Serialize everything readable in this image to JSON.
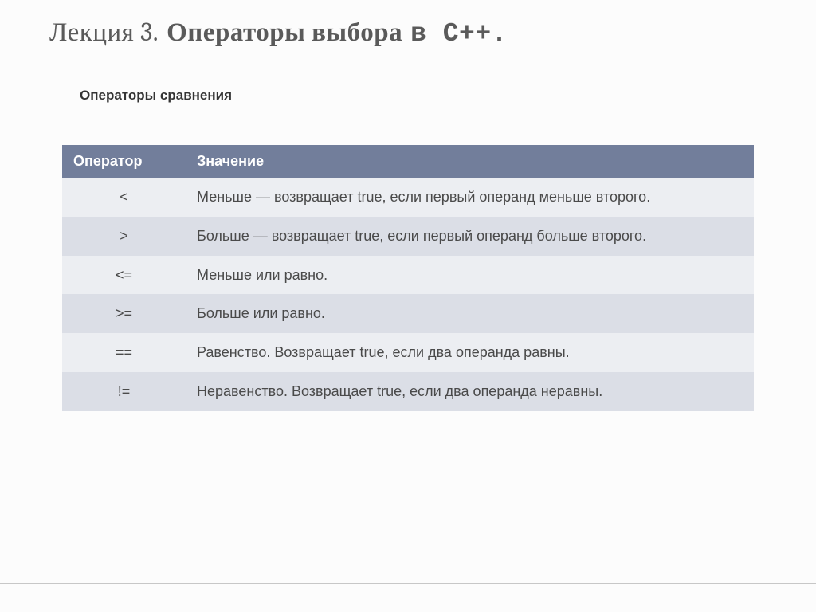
{
  "title": {
    "lecture": "Лекция 3.",
    "bold": "Операторы выбора",
    "mono": "в С++."
  },
  "subtitle": "Операторы сравнения",
  "table": {
    "header": {
      "operator": "Оператор",
      "value": "Значение"
    },
    "rows": [
      {
        "op": "<",
        "val": "Меньше — возвращает true, если первый операнд меньше второго."
      },
      {
        "op": ">",
        "val": "Больше — возвращает true, если первый операнд больше второго."
      },
      {
        "op": "<=",
        "val": "Меньше или равно."
      },
      {
        "op": ">=",
        "val": "Больше или равно."
      },
      {
        "op": "==",
        "val": "Равенство. Возвращает true, если два операнда равны."
      },
      {
        "op": "!=",
        "val": "Неравенство. Возвращает true, если два операнда неравны."
      }
    ]
  }
}
